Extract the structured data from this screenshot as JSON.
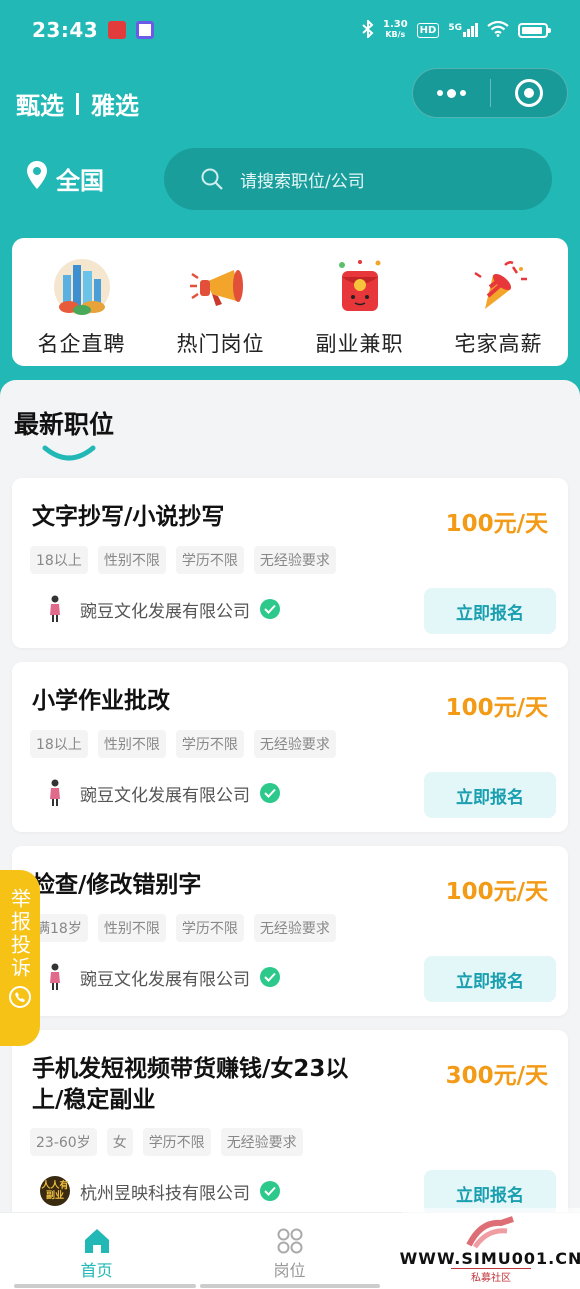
{
  "status_bar": {
    "time": "23:43",
    "net_speed_value": "1.30",
    "net_speed_unit": "KB/s",
    "hd": "HD",
    "signal_label": "5G"
  },
  "header": {
    "brand_left": "甄选",
    "brand_right": "雅选"
  },
  "location": {
    "label": "全国"
  },
  "search": {
    "placeholder": "请搜索职位/公司"
  },
  "categories": [
    {
      "label": "名企直聘",
      "icon": "city-buildings-icon"
    },
    {
      "label": "热门岗位",
      "icon": "megaphone-icon"
    },
    {
      "label": "副业兼职",
      "icon": "red-envelope-icon"
    },
    {
      "label": "宅家高薪",
      "icon": "party-popper-icon"
    }
  ],
  "section": {
    "title": "最新职位"
  },
  "jobs": [
    {
      "title": "文字抄写/小说抄写",
      "pay": "100元/天",
      "tags": [
        "18以上",
        "性别不限",
        "学历不限",
        "无经验要求"
      ],
      "company": "豌豆文化发展有限公司",
      "apply_label": "立即报名"
    },
    {
      "title": "小学作业批改",
      "pay": "100元/天",
      "tags": [
        "18以上",
        "性别不限",
        "学历不限",
        "无经验要求"
      ],
      "company": "豌豆文化发展有限公司",
      "apply_label": "立即报名"
    },
    {
      "title": "检查/修改错别字",
      "pay": "100元/天",
      "tags": [
        "满18岁",
        "性别不限",
        "学历不限",
        "无经验要求"
      ],
      "company": "豌豆文化发展有限公司",
      "apply_label": "立即报名"
    },
    {
      "title_line1": "手机发短视频带货赚钱/女23以",
      "title_line2": "上/稳定副业",
      "pay": "300元/天",
      "tags": [
        "23-60岁",
        "女",
        "学历不限",
        "无经验要求"
      ],
      "company": "杭州昱映科技有限公司",
      "avatar_text": "人人有副业",
      "apply_label": "立即报名"
    }
  ],
  "report": {
    "label": "举报投诉"
  },
  "bottom_nav": {
    "home_label": "首页",
    "jobs_label": "岗位"
  },
  "watermark": {
    "url": "WWW.SIMU001.CN",
    "sub": "私募社区"
  },
  "colors": {
    "primary_teal": "#22b8b6",
    "pay_orange": "#f39a17",
    "report_yellow": "#f6c216",
    "verified_green": "#2cc98a"
  }
}
